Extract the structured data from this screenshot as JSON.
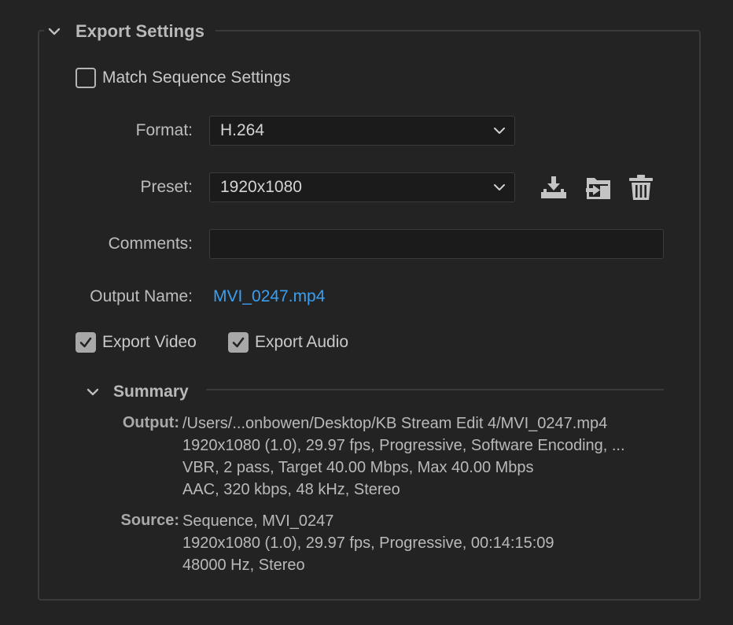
{
  "panel": {
    "title": "Export Settings"
  },
  "match_sequence": {
    "label": "Match Sequence Settings",
    "checked": false
  },
  "format": {
    "label": "Format:",
    "value": "H.264"
  },
  "preset": {
    "label": "Preset:",
    "value": "1920x1080",
    "icons": [
      "save-preset-icon",
      "import-preset-icon",
      "delete-preset-icon"
    ]
  },
  "comments": {
    "label": "Comments:",
    "value": ""
  },
  "output_name": {
    "label": "Output Name:",
    "value": "MVI_0247.mp4"
  },
  "export_video": {
    "label": "Export Video",
    "checked": true
  },
  "export_audio": {
    "label": "Export Audio",
    "checked": true
  },
  "summary": {
    "title": "Summary",
    "output_label": "Output:",
    "output_lines": [
      "/Users/...onbowen/Desktop/KB Stream Edit 4/MVI_0247.mp4",
      "1920x1080 (1.0), 29.97 fps, Progressive, Software Encoding, ...",
      "VBR, 2 pass, Target 40.00 Mbps, Max 40.00 Mbps",
      "AAC, 320 kbps, 48 kHz, Stereo"
    ],
    "source_label": "Source:",
    "source_lines": [
      "Sequence, MVI_0247",
      "1920x1080 (1.0), 29.97 fps, Progressive, 00:14:15:09",
      "48000 Hz, Stereo"
    ]
  },
  "colors": {
    "background": "#232323",
    "link": "#3a9ff0",
    "field_bg": "#1b1b1b"
  }
}
